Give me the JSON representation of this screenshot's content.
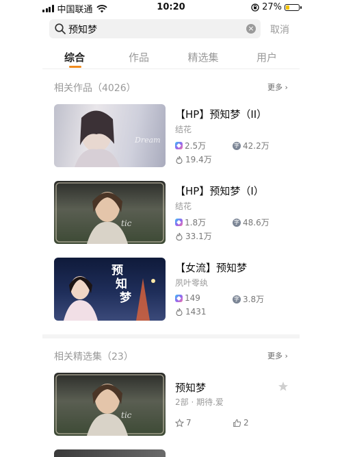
{
  "status_bar": {
    "carrier": "中国联通",
    "time": "10:20",
    "battery": "27%",
    "battery_level": 0.27
  },
  "search": {
    "query": "预知梦",
    "cancel_label": "取消"
  },
  "tabs": [
    {
      "label": "综合",
      "active": true
    },
    {
      "label": "作品",
      "active": false
    },
    {
      "label": "精选集",
      "active": false
    },
    {
      "label": "用户",
      "active": false
    }
  ],
  "works_section": {
    "title": "相关作品（4026）",
    "more": "更多",
    "items": [
      {
        "title": "【HP】预知梦（II）",
        "author": "结花",
        "heat": "2.5万",
        "words": "42.2万",
        "likes": "19.4万"
      },
      {
        "title": "【HP】预知梦（I）",
        "author": "结花",
        "heat": "1.8万",
        "words": "48.6万",
        "likes": "33.1万"
      },
      {
        "title": "【女流】预知梦",
        "author": "夙叶零纨",
        "heat": "149",
        "words": "3.8万",
        "likes": "1431",
        "cover_text": "预知梦"
      }
    ]
  },
  "collections_section": {
    "title": "相关精选集（23）",
    "more": "更多",
    "items": [
      {
        "title": "预知梦",
        "meta": "2部 · 期待.爱",
        "stars": "7",
        "likes": "2"
      }
    ]
  },
  "colors": {
    "accent": "#f08a1c",
    "muted": "#999999",
    "battery": "#f2c200"
  }
}
